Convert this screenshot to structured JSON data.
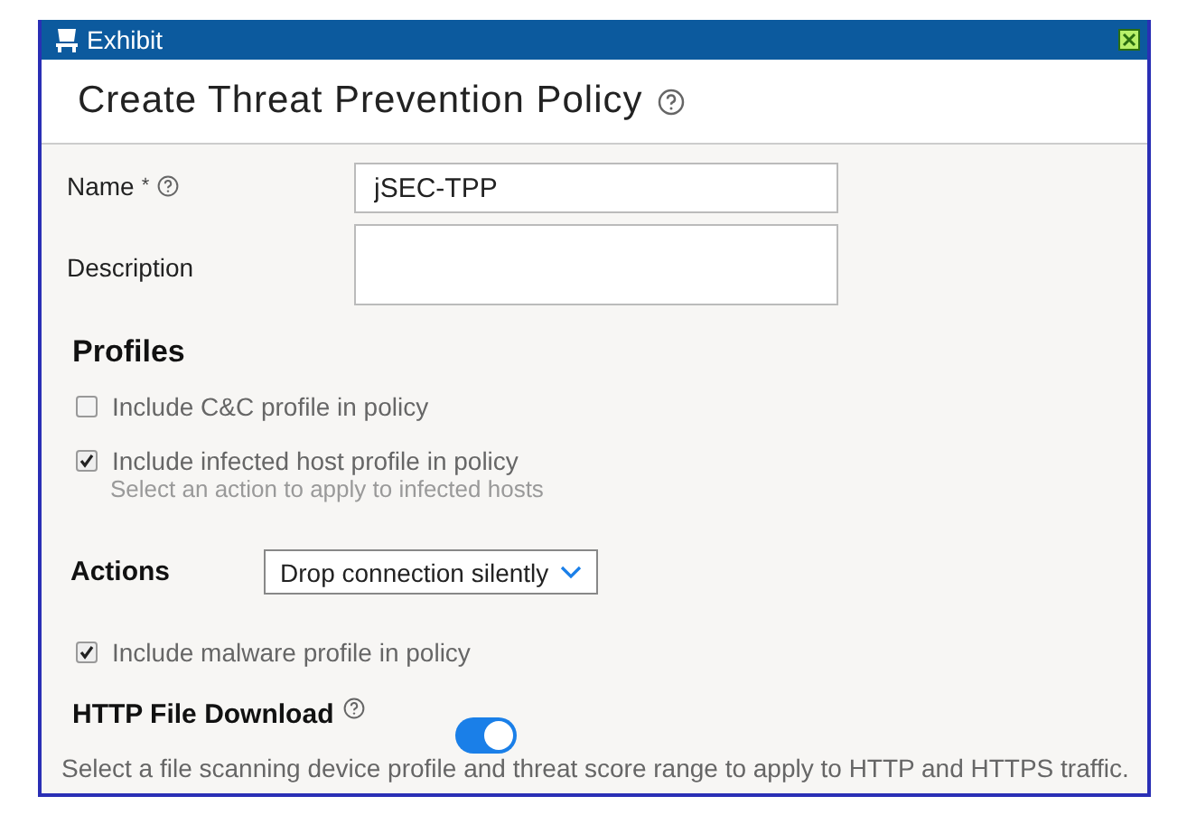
{
  "window": {
    "title": "Exhibit"
  },
  "header": {
    "title": "Create Threat Prevention Policy"
  },
  "fields": [
    {
      "label": "Name",
      "required_mark": "*",
      "help": true,
      "value": "jSEC-TPP"
    },
    {
      "label": "Description",
      "help": false
    }
  ],
  "profiles": {
    "title": "Profiles",
    "checks": [
      {
        "label": "Include C&C profile in policy",
        "checked": false
      },
      {
        "label": "Include infected host profile in policy",
        "checked": true,
        "hint": "Select an action to apply to infected hosts"
      }
    ]
  },
  "actions": {
    "label": "Actions",
    "value": "Drop connection silently"
  },
  "malware": {
    "label": "Include malware profile in policy",
    "checked": true
  },
  "http": {
    "label": "HTTP File Download",
    "on": true,
    "note": "Select a file scanning device profile and threat score range to apply to HTTP and HTTPS traffic."
  }
}
